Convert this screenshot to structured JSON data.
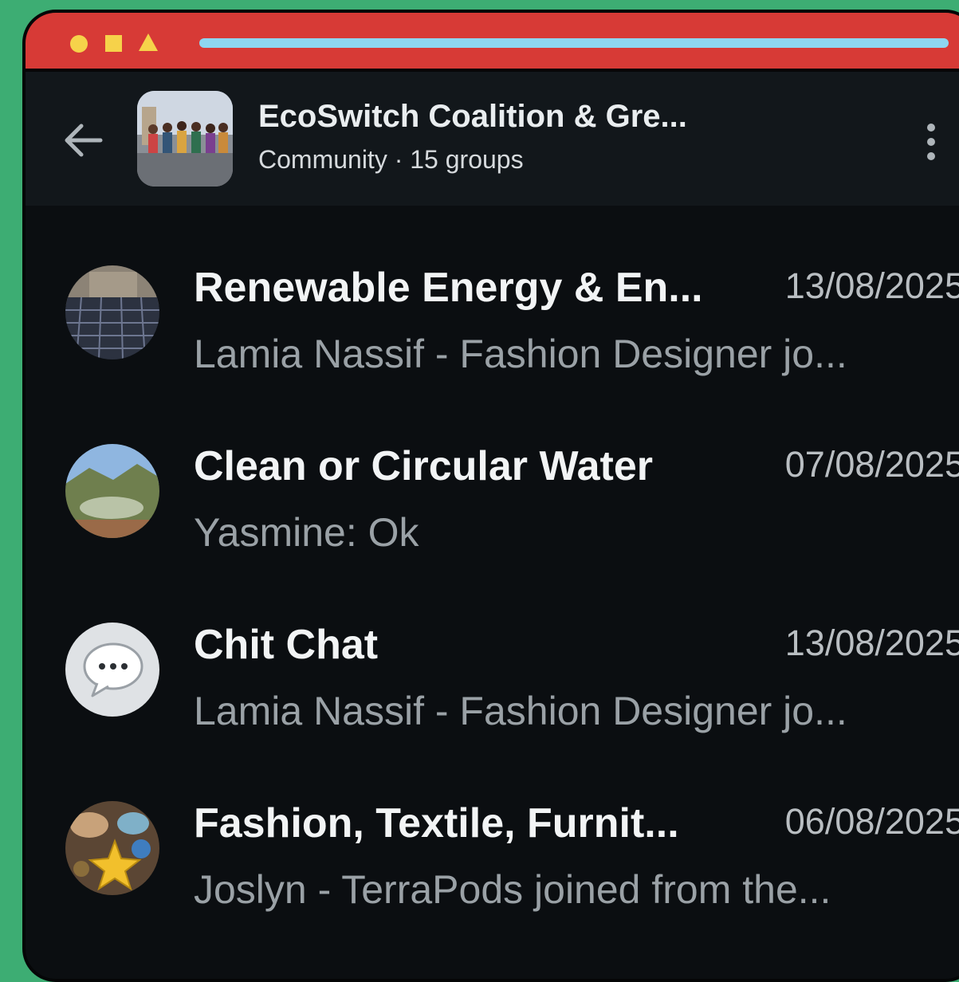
{
  "header": {
    "title": "EcoSwitch Coalition & Gre...",
    "subtitle": "Community · 15 groups",
    "back_icon": "arrow-left-icon",
    "menu_icon": "more-vertical-icon"
  },
  "colors": {
    "background": "#3dad73",
    "titlebar": "#d73a36",
    "app_bg": "#0b0e11",
    "header_bg": "#12171b"
  },
  "groups": [
    {
      "name": "Renewable Energy & En...",
      "date": "13/08/2025",
      "preview": "Lamia Nassif - Fashion Designer jo...",
      "avatar": "solar-panels-photo"
    },
    {
      "name": "Clean or Circular Water",
      "date": "07/08/2025",
      "preview": "Yasmine: Ok",
      "avatar": "water-reservoir-photo"
    },
    {
      "name": "Chit Chat",
      "date": "13/08/2025",
      "preview": "Lamia Nassif - Fashion Designer jo...",
      "avatar": "chat-bubble-icon"
    },
    {
      "name": "Fashion, Textile, Furnit...",
      "date": "06/08/2025",
      "preview": "Joslyn - TerraPods joined from the...",
      "avatar": "craft-items-photo"
    }
  ]
}
